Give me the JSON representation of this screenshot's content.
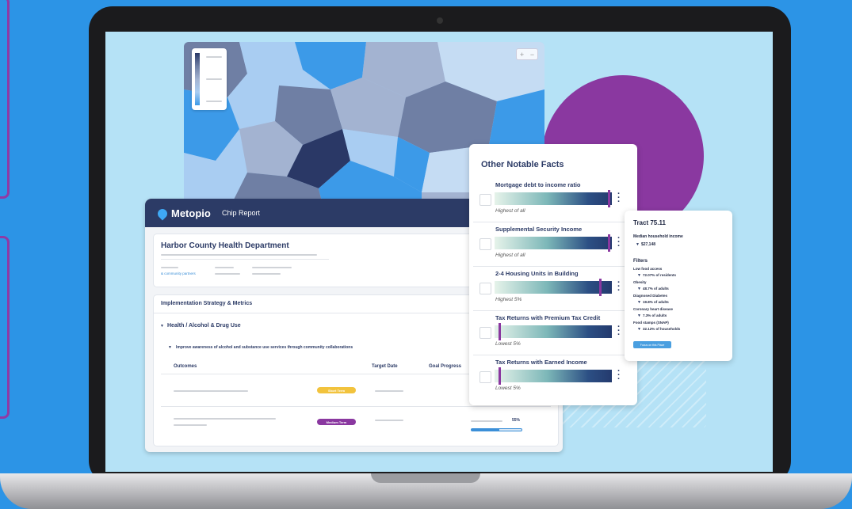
{
  "colors": {
    "background": "#2c94e6",
    "header": "#2c3b66",
    "accent": "#8a38a0",
    "link": "#3b8fd8"
  },
  "app": {
    "logo_text": "Metopio",
    "nav_item": "Chip Report",
    "org_name": "Harbor County Health Department",
    "partners_link": "& community partners",
    "section_title": "Implementation Strategy & Metrics",
    "category": "Health / Alcohol & Drug Use",
    "goal": "Improve awareness of alcohol and substance use services through community collaborations",
    "table": {
      "headers": [
        "Outcomes",
        "Target Date",
        "Goal Progress"
      ],
      "rows": [
        {
          "term": "Short Term",
          "term_color": "#f2c33d",
          "progress": ""
        },
        {
          "term": "Medium Term",
          "term_color": "#8a38a0",
          "progress": "55%",
          "progress_value": 0.55
        }
      ]
    }
  },
  "map": {
    "zoom_in": "+",
    "zoom_out": "−"
  },
  "facts": {
    "title": "Other Notable Facts",
    "items": [
      {
        "label": "Mortgage debt to income ratio",
        "note": "Highest of all",
        "marker": 0.97
      },
      {
        "label": "Supplemental Security Income",
        "note": "Highest of all",
        "marker": 0.97
      },
      {
        "label": "2-4 Housing Units in Building",
        "note": "Highest 5%",
        "marker": 0.9
      },
      {
        "label": "Tax Returns with Premium Tax Credit",
        "note": "Lowest 5%",
        "marker": 0.04
      },
      {
        "label": "Tax Returns with Earned Income",
        "note": "Lowest 5%",
        "marker": 0.04
      }
    ]
  },
  "tract": {
    "title": "Tract 75.11",
    "median_label": "Median household income",
    "median_value": "$27,148",
    "filters_label": "Filters",
    "filters": [
      {
        "name": "Low food access",
        "value": "72.07% of residents"
      },
      {
        "name": "Obesity",
        "value": "48.7% of adults"
      },
      {
        "name": "Diagnosed Diabetes",
        "value": "19.8% of adults"
      },
      {
        "name": "Coronary heart disease",
        "value": "7.3% of adults"
      },
      {
        "name": "Food stamps (SNAP)",
        "value": "32.12% of households"
      }
    ],
    "button": "Focus on this Place"
  }
}
